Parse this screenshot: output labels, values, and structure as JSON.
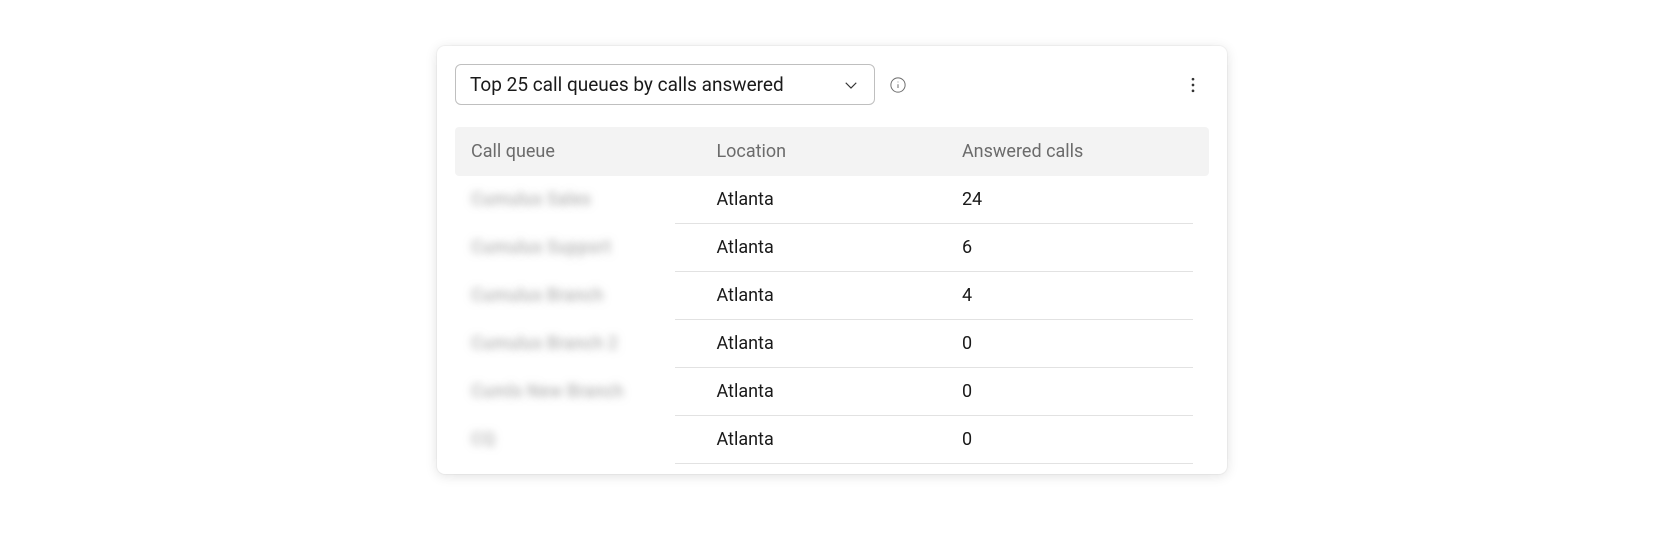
{
  "header": {
    "dropdown_label": "Top 25 call queues by calls answered"
  },
  "table": {
    "columns": {
      "queue": "Call queue",
      "location": "Location",
      "answered": "Answered calls"
    },
    "rows": [
      {
        "queue": "Cumulus Sales",
        "location": "Atlanta",
        "answered": "24"
      },
      {
        "queue": "Cumulus Support",
        "location": "Atlanta",
        "answered": "6"
      },
      {
        "queue": "Cumulus Branch",
        "location": "Atlanta",
        "answered": "4"
      },
      {
        "queue": "Cumulus Branch 2",
        "location": "Atlanta",
        "answered": "0"
      },
      {
        "queue": "Cumls New Branch",
        "location": "Atlanta",
        "answered": "0"
      },
      {
        "queue": "CQ",
        "location": "Atlanta",
        "answered": "0"
      }
    ]
  }
}
